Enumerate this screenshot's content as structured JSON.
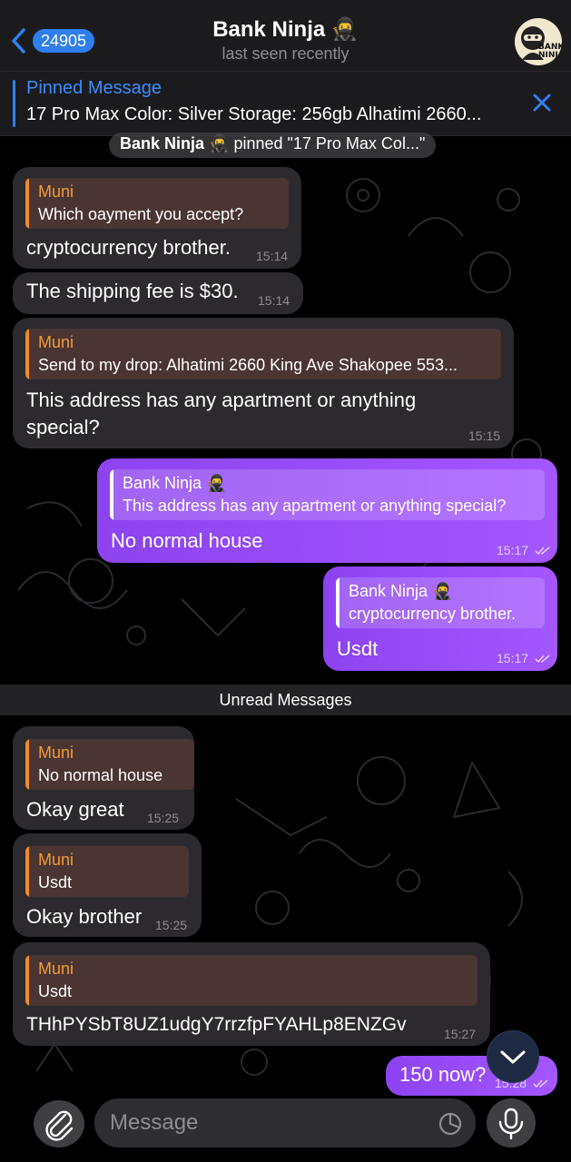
{
  "header": {
    "back_count": "24905",
    "title": "Bank Ninja 🥷",
    "status": "last seen recently",
    "avatar_text": "BANK NINJA"
  },
  "pinned": {
    "title": "Pinned Message",
    "text": "17 Pro Max Color: Silver Storage: 256gb Alhatimi 2660..."
  },
  "service": {
    "actor": "Bank Ninja 🥷",
    "text": "pinned \"17 Pro Max  Col...\""
  },
  "messages": [
    {
      "reply_name": "Muni",
      "reply_text": "Which oayment you accept?",
      "text": "cryptocurrency brother.",
      "time": "15:14"
    },
    {
      "text": "The shipping fee is $30.",
      "time": "15:14"
    },
    {
      "reply_name": "Muni",
      "reply_text": "Send to my drop: Alhatimi 2660 King Ave Shakopee 553...",
      "text": "This address has any apartment or anything special?",
      "time": "15:15"
    },
    {
      "reply_name": "Bank Ninja 🥷",
      "reply_text": "This address has any apartment or anything special?",
      "text": "No normal house",
      "time": "15:17"
    },
    {
      "reply_name": "Bank Ninja 🥷",
      "reply_text": "cryptocurrency brother.",
      "text": "Usdt",
      "time": "15:17"
    },
    {
      "reply_name": "Muni",
      "reply_text": "No normal house",
      "text": "Okay great",
      "time": "15:25"
    },
    {
      "reply_name": "Muni",
      "reply_text": "Usdt",
      "text": "Okay brother",
      "time": "15:25"
    },
    {
      "reply_name": "Muni",
      "reply_text": "Usdt",
      "text": "THhPYSbT8UZ1udgY7rrzfpFYAHLp8ENZGv",
      "time": "15:27"
    },
    {
      "text": "150 now?",
      "time": "15:28"
    }
  ],
  "unread_label": "Unread Messages",
  "composer": {
    "placeholder": "Message"
  },
  "colors": {
    "accent": "#2f7ff0",
    "outgoing": "#9a4dff",
    "incoming": "#2c2a2f",
    "reply_name_in": "#f39b3a"
  },
  "icons": [
    "chevron-left-icon",
    "close-icon",
    "chevron-down-icon",
    "paperclip-icon",
    "sticker-icon",
    "microphone-icon",
    "double-check-icon"
  ]
}
